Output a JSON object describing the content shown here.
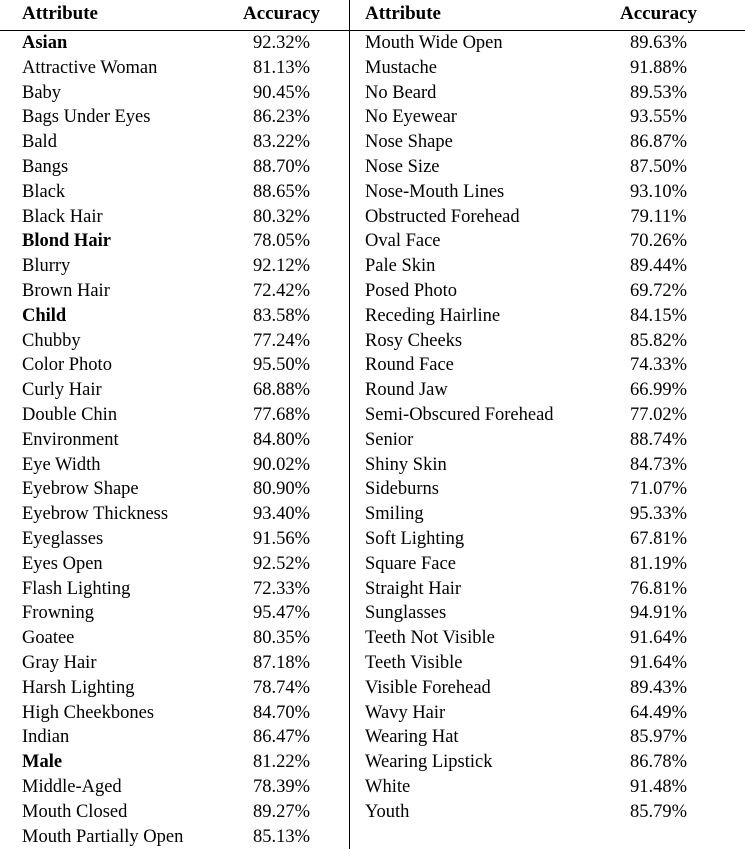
{
  "table": {
    "headers": {
      "attribute": "Attribute",
      "accuracy": "Accuracy"
    },
    "left_column": [
      {
        "attribute": "Asian",
        "accuracy": "92.32%",
        "bold": true
      },
      {
        "attribute": "Attractive Woman",
        "accuracy": "81.13%",
        "bold": false
      },
      {
        "attribute": "Baby",
        "accuracy": "90.45%",
        "bold": false
      },
      {
        "attribute": "Bags Under Eyes",
        "accuracy": "86.23%",
        "bold": false
      },
      {
        "attribute": "Bald",
        "accuracy": "83.22%",
        "bold": false
      },
      {
        "attribute": "Bangs",
        "accuracy": "88.70%",
        "bold": false
      },
      {
        "attribute": "Black",
        "accuracy": "88.65%",
        "bold": false
      },
      {
        "attribute": "Black Hair",
        "accuracy": "80.32%",
        "bold": false
      },
      {
        "attribute": "Blond Hair",
        "accuracy": "78.05%",
        "bold": true
      },
      {
        "attribute": "Blurry",
        "accuracy": "92.12%",
        "bold": false
      },
      {
        "attribute": "Brown Hair",
        "accuracy": "72.42%",
        "bold": false
      },
      {
        "attribute": "Child",
        "accuracy": "83.58%",
        "bold": true
      },
      {
        "attribute": "Chubby",
        "accuracy": "77.24%",
        "bold": false
      },
      {
        "attribute": "Color Photo",
        "accuracy": "95.50%",
        "bold": false
      },
      {
        "attribute": "Curly Hair",
        "accuracy": "68.88%",
        "bold": false
      },
      {
        "attribute": "Double Chin",
        "accuracy": "77.68%",
        "bold": false
      },
      {
        "attribute": "Environment",
        "accuracy": "84.80%",
        "bold": false
      },
      {
        "attribute": "Eye Width",
        "accuracy": "90.02%",
        "bold": false
      },
      {
        "attribute": "Eyebrow Shape",
        "accuracy": "80.90%",
        "bold": false
      },
      {
        "attribute": "Eyebrow Thickness",
        "accuracy": "93.40%",
        "bold": false
      },
      {
        "attribute": "Eyeglasses",
        "accuracy": "91.56%",
        "bold": false
      },
      {
        "attribute": "Eyes Open",
        "accuracy": "92.52%",
        "bold": false
      },
      {
        "attribute": "Flash Lighting",
        "accuracy": "72.33%",
        "bold": false
      },
      {
        "attribute": "Frowning",
        "accuracy": "95.47%",
        "bold": false
      },
      {
        "attribute": "Goatee",
        "accuracy": "80.35%",
        "bold": false
      },
      {
        "attribute": "Gray Hair",
        "accuracy": "87.18%",
        "bold": false
      },
      {
        "attribute": "Harsh Lighting",
        "accuracy": "78.74%",
        "bold": false
      },
      {
        "attribute": "High Cheekbones",
        "accuracy": "84.70%",
        "bold": false
      },
      {
        "attribute": "Indian",
        "accuracy": "86.47%",
        "bold": false
      },
      {
        "attribute": "Male",
        "accuracy": "81.22%",
        "bold": true
      },
      {
        "attribute": "Middle-Aged",
        "accuracy": "78.39%",
        "bold": false
      },
      {
        "attribute": "Mouth Closed",
        "accuracy": "89.27%",
        "bold": false
      },
      {
        "attribute": "Mouth Partially Open",
        "accuracy": "85.13%",
        "bold": false
      }
    ],
    "right_column": [
      {
        "attribute": "Mouth Wide Open",
        "accuracy": "89.63%",
        "bold": false
      },
      {
        "attribute": "Mustache",
        "accuracy": "91.88%",
        "bold": false
      },
      {
        "attribute": "No Beard",
        "accuracy": "89.53%",
        "bold": false
      },
      {
        "attribute": "No Eyewear",
        "accuracy": "93.55%",
        "bold": false
      },
      {
        "attribute": "Nose Shape",
        "accuracy": "86.87%",
        "bold": false
      },
      {
        "attribute": "Nose Size",
        "accuracy": "87.50%",
        "bold": false
      },
      {
        "attribute": "Nose-Mouth Lines",
        "accuracy": "93.10%",
        "bold": false
      },
      {
        "attribute": "Obstructed Forehead",
        "accuracy": "79.11%",
        "bold": false
      },
      {
        "attribute": "Oval Face",
        "accuracy": "70.26%",
        "bold": false
      },
      {
        "attribute": "Pale Skin",
        "accuracy": "89.44%",
        "bold": false
      },
      {
        "attribute": "Posed Photo",
        "accuracy": "69.72%",
        "bold": false
      },
      {
        "attribute": "Receding Hairline",
        "accuracy": "84.15%",
        "bold": false
      },
      {
        "attribute": "Rosy Cheeks",
        "accuracy": "85.82%",
        "bold": false
      },
      {
        "attribute": "Round Face",
        "accuracy": "74.33%",
        "bold": false
      },
      {
        "attribute": "Round Jaw",
        "accuracy": "66.99%",
        "bold": false
      },
      {
        "attribute": "Semi-Obscured Forehead",
        "accuracy": "77.02%",
        "bold": false
      },
      {
        "attribute": "Senior",
        "accuracy": "88.74%",
        "bold": false
      },
      {
        "attribute": "Shiny Skin",
        "accuracy": "84.73%",
        "bold": false
      },
      {
        "attribute": "Sideburns",
        "accuracy": "71.07%",
        "bold": false
      },
      {
        "attribute": "Smiling",
        "accuracy": "95.33%",
        "bold": false
      },
      {
        "attribute": "Soft Lighting",
        "accuracy": "67.81%",
        "bold": false
      },
      {
        "attribute": "Square Face",
        "accuracy": "81.19%",
        "bold": false
      },
      {
        "attribute": "Straight Hair",
        "accuracy": "76.81%",
        "bold": false
      },
      {
        "attribute": "Sunglasses",
        "accuracy": "94.91%",
        "bold": false
      },
      {
        "attribute": "Teeth Not Visible",
        "accuracy": "91.64%",
        "bold": false
      },
      {
        "attribute": "Teeth Visible",
        "accuracy": "91.64%",
        "bold": false
      },
      {
        "attribute": "Visible Forehead",
        "accuracy": "89.43%",
        "bold": false
      },
      {
        "attribute": "Wavy Hair",
        "accuracy": "64.49%",
        "bold": false
      },
      {
        "attribute": "Wearing Hat",
        "accuracy": "85.97%",
        "bold": false
      },
      {
        "attribute": "Wearing Lipstick",
        "accuracy": "86.78%",
        "bold": false
      },
      {
        "attribute": "White",
        "accuracy": "91.48%",
        "bold": false
      },
      {
        "attribute": "Youth",
        "accuracy": "85.79%",
        "bold": false
      }
    ]
  }
}
